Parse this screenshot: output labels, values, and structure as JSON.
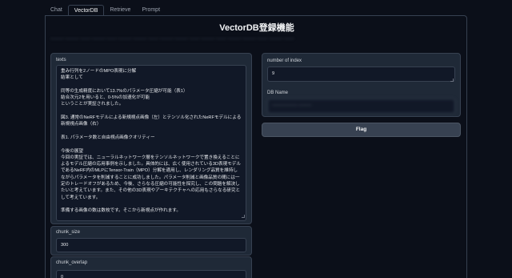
{
  "tabs": [
    {
      "label": "Chat"
    },
    {
      "label": "VectorDB"
    },
    {
      "label": "Retrieve"
    },
    {
      "label": "Prompt"
    }
  ],
  "page_title": "VectorDB登録機能",
  "description": "──── ──── ─── ──── ─── ──── ──── ─── ──── ──── ─── ──── ─── ──── ──── ─── ──── ───",
  "texts": {
    "label": "texts",
    "value": "重み行列を2ノードのMPO表現に分解\n結果として\n\n同等の生成精度において13.7%のパラメータ圧縮が可能（表1）\n結合次元2を用いると、0-5%の加速化が可能\nということが実証されました。\n\n図3. 通常のNeRFモデルによる新規視点画像（左）とテンソル化されたNeRFモデルによる新規視点画像（右）\n\n表1. パラメータ数と自由視点画像クオリティー\n\n今後の展望\n今回の実証では、ニューラルネットワーク層をテンソルネットワークで置き換えることによるモデル圧縮の応用事例を示しました。具体的には、広く使用されている3D表現モデルであるNeRF内のMLPにTensor-Train（MPO）分解を適用し、レンダリング品質を維持しながらパラメータを削減することに成功しました。パラメータ削減と画像品質の間には一定のトレードオフがあるため、今後、さらなる圧縮の可能性を探究し、この問題を解決したいと考えています。また、その他の3D表現やアーキテクチャへの応用もさらなる研究として考えています。\n\n準備する画像の数は数枚です。そこから新視点が作れます。"
  },
  "chunk_size": {
    "label": "chunk_size",
    "value": "300"
  },
  "chunk_overlap": {
    "label": "chunk_overlap",
    "value": "0"
  },
  "number_of_index": {
    "label": "number of index",
    "value": "9"
  },
  "db_name": {
    "label": "DB Name",
    "value": "──────── ────"
  },
  "flag_button": {
    "label": "Flag"
  }
}
